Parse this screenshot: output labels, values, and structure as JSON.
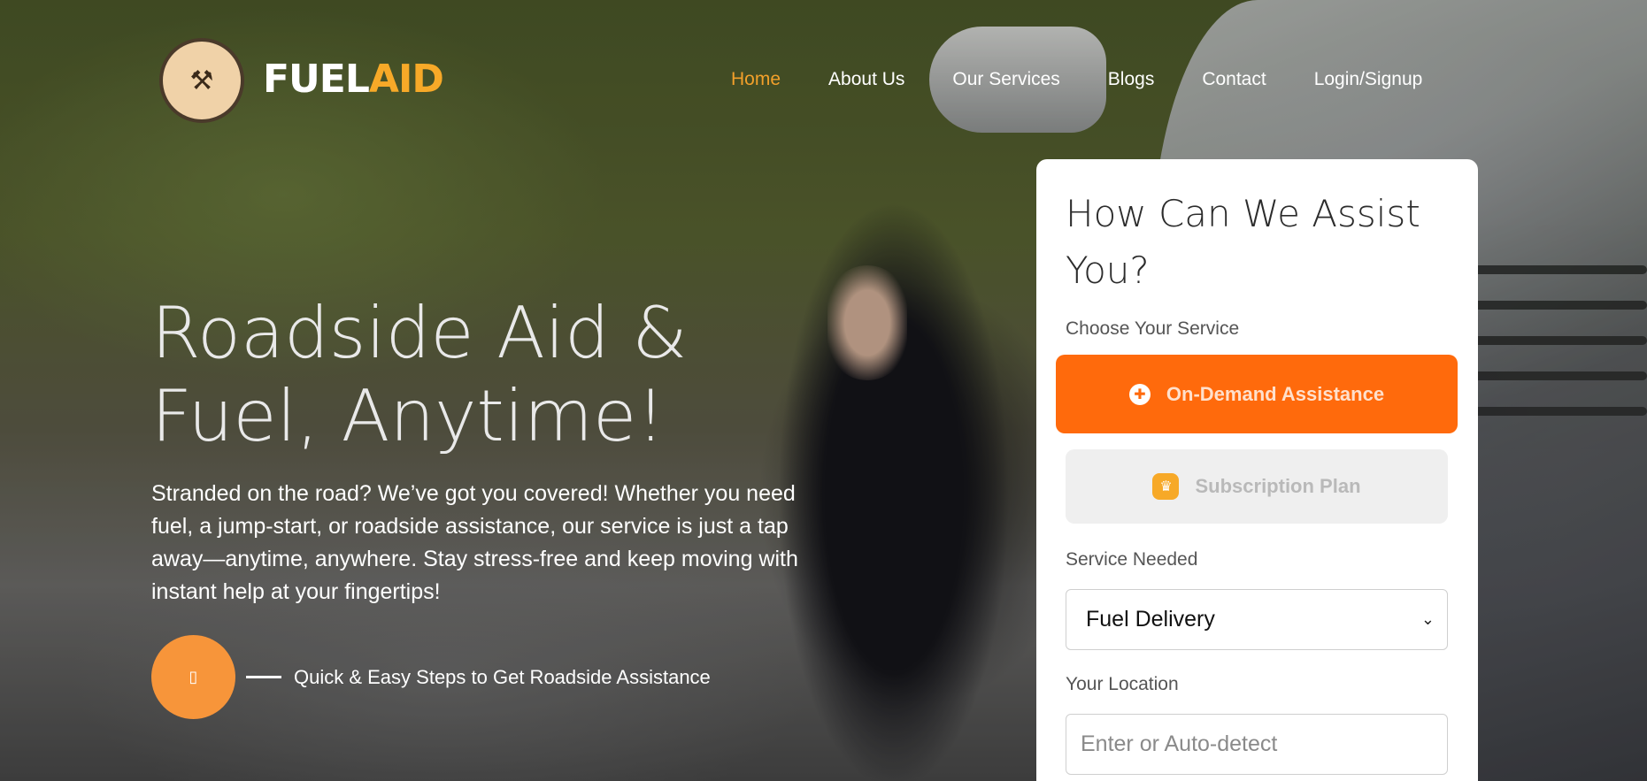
{
  "brand": {
    "badge_icon": "wrench-cross-icon",
    "badge_glyph": "⚒",
    "name_part1": "FUEL",
    "name_part2": "AID",
    "accent_color": "#f7a928"
  },
  "nav": {
    "items": [
      {
        "label": "Home",
        "active": true
      },
      {
        "label": "About Us"
      },
      {
        "label": "Our Services"
      },
      {
        "label": "Blogs"
      },
      {
        "label": "Contact"
      },
      {
        "label": "Login/Signup"
      }
    ]
  },
  "hero": {
    "headline_line1": "Roadside Aid &",
    "headline_line2": "Fuel, Anytime!",
    "subtext": "Stranded on the road? We’ve got you covered! Whether you need fuel, a jump-start, or roadside assistance, our service is just a tap away—anytime, anywhere. Stay stress-free and keep moving with instant help at your fingertips!",
    "cta_icon_glyph": "▯",
    "cta_text": "Quick & Easy Steps to Get Roadside Assistance"
  },
  "form": {
    "title": "How Can We Assist You?",
    "choose_label": "Choose Your Service",
    "service_options": [
      {
        "label": "On-Demand Assistance",
        "icon": "rocket-icon",
        "glyph": "✚",
        "selected": true
      },
      {
        "label": "Subscription Plan",
        "icon": "crown-icon",
        "glyph": "♛",
        "selected": false
      }
    ],
    "service_needed_label": "Service Needed",
    "service_needed_value": "Fuel Delivery",
    "location_label": "Your Location",
    "location_placeholder": "Enter or Auto-detect",
    "primary_color": "#ff6a0c"
  }
}
